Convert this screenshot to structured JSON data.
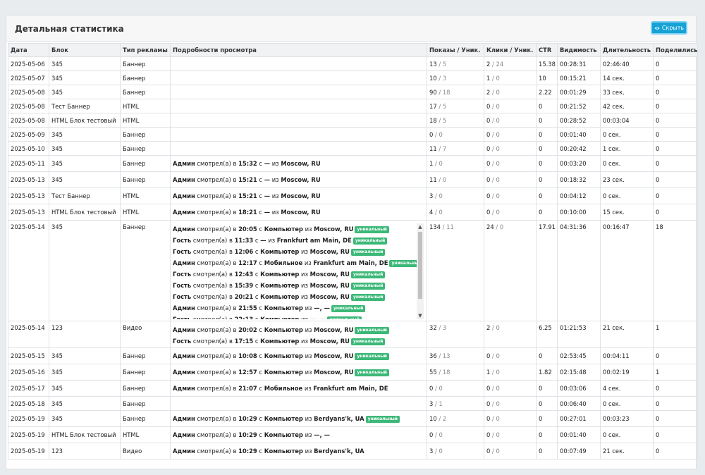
{
  "header": {
    "title": "Детальная статистика",
    "hide_label": "Скрыть"
  },
  "columns": [
    "Дата",
    "Блок",
    "Тип рекламы",
    "Подробности просмотра",
    "Показы / Уник.",
    "Клики / Уник.",
    "CTR",
    "Видимость",
    "Длительность",
    "Поделились"
  ],
  "rows": [
    {
      "date": "2025-05-06",
      "block": "345",
      "type": "Баннер",
      "details": [],
      "shows": "13",
      "shows_u": "5",
      "clicks": "2",
      "clicks_u": "24",
      "ctr": "15.38",
      "vis": "00:28:31",
      "dur": "02:46:40",
      "shared": "0"
    },
    {
      "date": "2025-05-07",
      "block": "345",
      "type": "Баннер",
      "details": [],
      "shows": "10",
      "shows_u": "3",
      "clicks": "1",
      "clicks_u": "0",
      "ctr": "10",
      "vis": "00:15:21",
      "dur": "14 сек.",
      "shared": "0"
    },
    {
      "date": "2025-05-08",
      "block": "345",
      "type": "Баннер",
      "details": [],
      "shows": "90",
      "shows_u": "18",
      "clicks": "2",
      "clicks_u": "0",
      "ctr": "2.22",
      "vis": "00:01:29",
      "dur": "33 сек.",
      "shared": "0"
    },
    {
      "date": "2025-05-08",
      "block": "Тест Баннер",
      "type": "HTML",
      "details": [],
      "shows": "17",
      "shows_u": "5",
      "clicks": "0",
      "clicks_u": "0",
      "ctr": "0",
      "vis": "00:21:52",
      "dur": "42 сек.",
      "shared": "0"
    },
    {
      "date": "2025-05-08",
      "block": "HTML Блок тестовый",
      "type": "HTML",
      "details": [],
      "shows": "18",
      "shows_u": "5",
      "clicks": "0",
      "clicks_u": "0",
      "ctr": "0",
      "vis": "00:28:52",
      "dur": "00:03:04",
      "shared": "0"
    },
    {
      "date": "2025-05-09",
      "block": "345",
      "type": "Баннер",
      "details": [],
      "shows": "0",
      "shows_u": "0",
      "clicks": "0",
      "clicks_u": "0",
      "ctr": "0",
      "vis": "00:01:40",
      "dur": "0 сек.",
      "shared": "0"
    },
    {
      "date": "2025-05-10",
      "block": "345",
      "type": "Баннер",
      "details": [],
      "shows": "11",
      "shows_u": "7",
      "clicks": "0",
      "clicks_u": "0",
      "ctr": "0",
      "vis": "00:20:42",
      "dur": "1 сек.",
      "shared": "0"
    },
    {
      "date": "2025-05-11",
      "block": "345",
      "type": "Баннер",
      "details": [
        {
          "who": "Админ",
          "time": "15:32",
          "device": "—",
          "loc": "Moscow, RU",
          "uniq": ""
        }
      ],
      "shows": "1",
      "shows_u": "0",
      "clicks": "0",
      "clicks_u": "0",
      "ctr": "0",
      "vis": "00:03:20",
      "dur": "0 сек.",
      "shared": "0"
    },
    {
      "date": "2025-05-13",
      "block": "345",
      "type": "Баннер",
      "details": [
        {
          "who": "Админ",
          "time": "15:21",
          "device": "—",
          "loc": "Moscow, RU",
          "uniq": ""
        }
      ],
      "shows": "11",
      "shows_u": "0",
      "clicks": "0",
      "clicks_u": "0",
      "ctr": "0",
      "vis": "00:18:32",
      "dur": "23 сек.",
      "shared": "0"
    },
    {
      "date": "2025-05-13",
      "block": "Тест Баннер",
      "type": "HTML",
      "details": [
        {
          "who": "Админ",
          "time": "15:21",
          "device": "—",
          "loc": "Moscow, RU",
          "uniq": ""
        }
      ],
      "shows": "3",
      "shows_u": "0",
      "clicks": "0",
      "clicks_u": "0",
      "ctr": "0",
      "vis": "00:04:12",
      "dur": "0 сек.",
      "shared": "0"
    },
    {
      "date": "2025-05-13",
      "block": "HTML Блок тестовый",
      "type": "HTML",
      "details": [
        {
          "who": "Админ",
          "time": "18:21",
          "device": "—",
          "loc": "Moscow, RU",
          "uniq": ""
        }
      ],
      "shows": "4",
      "shows_u": "0",
      "clicks": "0",
      "clicks_u": "0",
      "ctr": "0",
      "vis": "00:10:00",
      "dur": "15 сек.",
      "shared": "0"
    },
    {
      "date": "2025-05-14",
      "block": "345",
      "type": "Баннер",
      "scroll": true,
      "details": [
        {
          "who": "Админ",
          "time": "20:05",
          "device": "Компьютер",
          "loc": "Moscow, RU",
          "uniq": "уникальный"
        },
        {
          "who": "Гость",
          "time": "11:33",
          "device": "—",
          "loc": "Frankfurt am Main, DE",
          "uniq": "уникальный"
        },
        {
          "who": "Гость",
          "time": "12:06",
          "device": "Компьютер",
          "loc": "Moscow, RU",
          "uniq": "уникальный"
        },
        {
          "who": "Админ",
          "time": "12:17",
          "device": "Мобильное",
          "loc": "Frankfurt am Main, DE",
          "uniq": "уникальный"
        },
        {
          "who": "Гость",
          "time": "12:43",
          "device": "Компьютер",
          "loc": "Moscow, RU",
          "uniq": "уникальный"
        },
        {
          "who": "Гость",
          "time": "15:39",
          "device": "Компьютер",
          "loc": "Moscow, RU",
          "uniq": "уникальный"
        },
        {
          "who": "Гость",
          "time": "20:21",
          "device": "Компьютер",
          "loc": "Moscow, RU",
          "uniq": "уникальный"
        },
        {
          "who": "Админ",
          "time": "21:55",
          "device": "Компьютер",
          "loc": "—, —",
          "uniq": "уникальный"
        },
        {
          "who": "Гость",
          "time": "22:13",
          "device": "Компьютер",
          "loc": "—, —",
          "uniq": "уникальный"
        }
      ],
      "shows": "134",
      "shows_u": "11",
      "clicks": "24",
      "clicks_u": "0",
      "ctr": "17.91",
      "vis": "04:31:36",
      "dur": "00:16:47",
      "shared": "18"
    },
    {
      "date": "2025-05-14",
      "block": "123",
      "type": "Видео",
      "details": [
        {
          "who": "Админ",
          "time": "20:02",
          "device": "Компьютер",
          "loc": "Moscow, RU",
          "uniq": "уникальный"
        },
        {
          "who": "Гость",
          "time": "17:15",
          "device": "Компьютер",
          "loc": "Moscow, RU",
          "uniq": "уникальный"
        }
      ],
      "shows": "32",
      "shows_u": "3",
      "clicks": "2",
      "clicks_u": "0",
      "ctr": "6.25",
      "vis": "01:21:53",
      "dur": "21 сек.",
      "shared": "1"
    },
    {
      "date": "2025-05-15",
      "block": "345",
      "type": "Баннер",
      "details": [
        {
          "who": "Админ",
          "time": "10:08",
          "device": "Компьютер",
          "loc": "Moscow, RU",
          "uniq": "уникальный"
        }
      ],
      "shows": "36",
      "shows_u": "13",
      "clicks": "0",
      "clicks_u": "0",
      "ctr": "0",
      "vis": "02:53:45",
      "dur": "00:04:11",
      "shared": "0"
    },
    {
      "date": "2025-05-16",
      "block": "345",
      "type": "Баннер",
      "details": [
        {
          "who": "Админ",
          "time": "12:57",
          "device": "Компьютер",
          "loc": "Moscow, RU",
          "uniq": "уникальный"
        }
      ],
      "shows": "55",
      "shows_u": "18",
      "clicks": "1",
      "clicks_u": "0",
      "ctr": "1.82",
      "vis": "02:15:48",
      "dur": "00:02:19",
      "shared": "1"
    },
    {
      "date": "2025-05-17",
      "block": "345",
      "type": "Баннер",
      "details": [
        {
          "who": "Админ",
          "time": "21:07",
          "device": "Мобильное",
          "loc": "Frankfurt am Main, DE",
          "uniq": ""
        }
      ],
      "shows": "0",
      "shows_u": "0",
      "clicks": "0",
      "clicks_u": "0",
      "ctr": "0",
      "vis": "00:03:06",
      "dur": "4 сек.",
      "shared": "0"
    },
    {
      "date": "2025-05-18",
      "block": "345",
      "type": "Баннер",
      "details": [],
      "shows": "3",
      "shows_u": "1",
      "clicks": "0",
      "clicks_u": "0",
      "ctr": "0",
      "vis": "00:06:40",
      "dur": "0 сек.",
      "shared": "0"
    },
    {
      "date": "2025-05-19",
      "block": "345",
      "type": "Баннер",
      "details": [
        {
          "who": "Админ",
          "time": "10:29",
          "device": "Компьютер",
          "loc": "Berdyans'k, UA",
          "uniq": "уникальный"
        }
      ],
      "shows": "10",
      "shows_u": "2",
      "clicks": "0",
      "clicks_u": "0",
      "ctr": "0",
      "vis": "00:27:01",
      "dur": "00:03:23",
      "shared": "0"
    },
    {
      "date": "2025-05-19",
      "block": "HTML Блок тестовый",
      "type": "HTML",
      "details": [
        {
          "who": "Админ",
          "time": "10:29",
          "device": "Компьютер",
          "loc": "—, —",
          "uniq": ""
        }
      ],
      "shows": "0",
      "shows_u": "0",
      "clicks": "0",
      "clicks_u": "0",
      "ctr": "0",
      "vis": "00:01:40",
      "dur": "0 сек.",
      "shared": "0"
    },
    {
      "date": "2025-05-19",
      "block": "123",
      "type": "Видео",
      "details": [
        {
          "who": "Админ",
          "time": "10:29",
          "device": "Компьютер",
          "loc": "Berdyans'k, UA",
          "uniq": ""
        }
      ],
      "shows": "3",
      "shows_u": "0",
      "clicks": "0",
      "clicks_u": "0",
      "ctr": "0",
      "vis": "00:07:49",
      "dur": "21 сек.",
      "shared": "0"
    }
  ],
  "labels": {
    "viewed": "смотрел(а) в",
    "with": "с",
    "from": "из"
  },
  "colors": {
    "accent": "#17a2d6",
    "badge": "#3cb878"
  }
}
